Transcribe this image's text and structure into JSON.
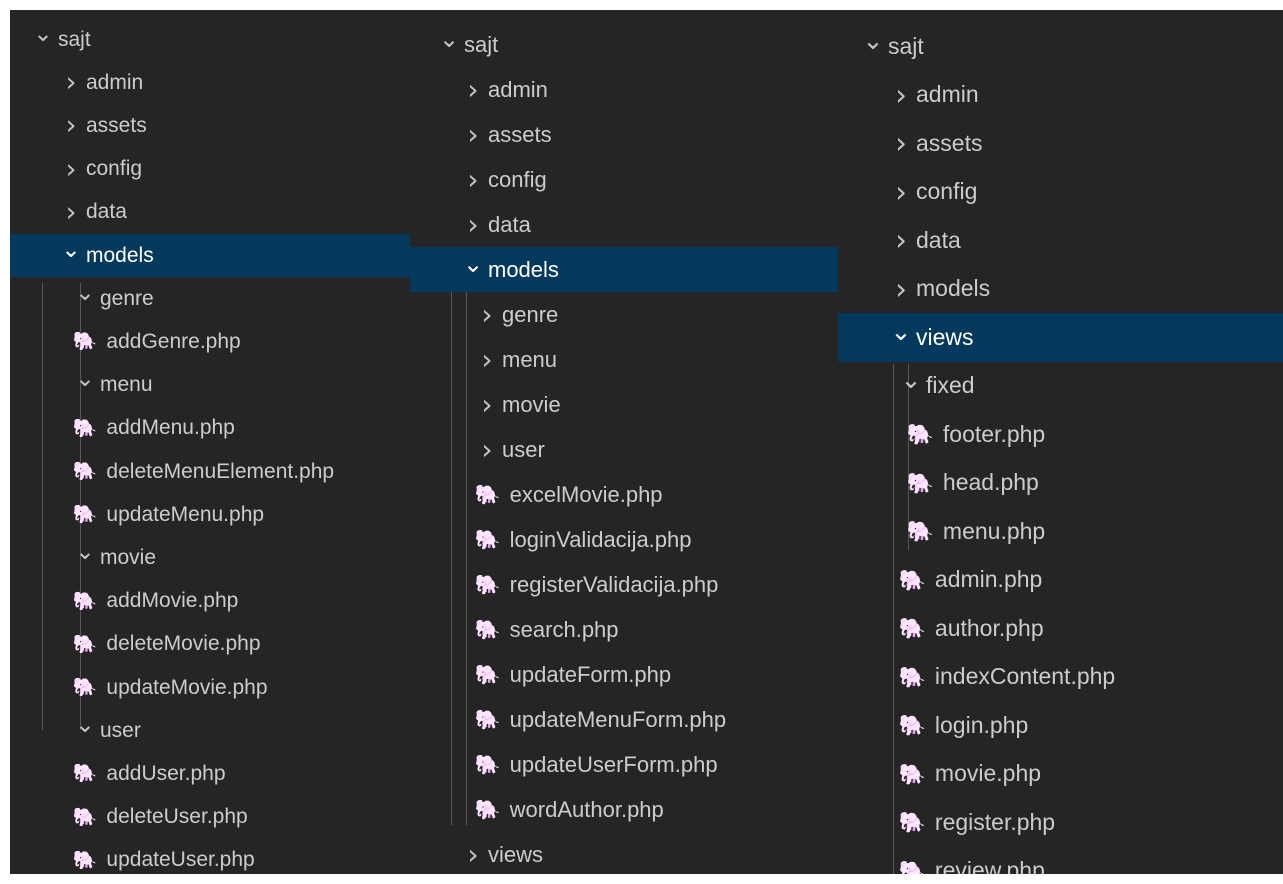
{
  "explorer_left": {
    "rows": [
      {
        "label": "sajt",
        "kind": "folder",
        "expanded": true,
        "depth": 0
      },
      {
        "label": "admin",
        "kind": "folder",
        "expanded": false,
        "depth": 1
      },
      {
        "label": "assets",
        "kind": "folder",
        "expanded": false,
        "depth": 1
      },
      {
        "label": "config",
        "kind": "folder",
        "expanded": false,
        "depth": 1
      },
      {
        "label": "data",
        "kind": "folder",
        "expanded": false,
        "depth": 1
      },
      {
        "label": "models",
        "kind": "folder",
        "expanded": true,
        "depth": 1,
        "selected": true
      },
      {
        "label": "genre",
        "kind": "folder",
        "expanded": true,
        "depth": 2
      },
      {
        "label": "addGenre.php",
        "kind": "php",
        "depth": 3
      },
      {
        "label": "menu",
        "kind": "folder",
        "expanded": true,
        "depth": 2
      },
      {
        "label": "addMenu.php",
        "kind": "php",
        "depth": 3
      },
      {
        "label": "deleteMenuElement.php",
        "kind": "php",
        "depth": 3
      },
      {
        "label": "updateMenu.php",
        "kind": "php",
        "depth": 3
      },
      {
        "label": "movie",
        "kind": "folder",
        "expanded": true,
        "depth": 2
      },
      {
        "label": "addMovie.php",
        "kind": "php",
        "depth": 3
      },
      {
        "label": "deleteMovie.php",
        "kind": "php",
        "depth": 3
      },
      {
        "label": "updateMovie.php",
        "kind": "php",
        "depth": 3
      },
      {
        "label": "user",
        "kind": "folder",
        "expanded": true,
        "depth": 2
      },
      {
        "label": "addUser.php",
        "kind": "php",
        "depth": 3
      },
      {
        "label": "deleteUser.php",
        "kind": "php",
        "depth": 3
      },
      {
        "label": "updateUser.php",
        "kind": "php",
        "depth": 3
      }
    ]
  },
  "explorer_middle": {
    "rows": [
      {
        "label": "sajt",
        "kind": "folder",
        "expanded": true,
        "depth": 0
      },
      {
        "label": "admin",
        "kind": "folder",
        "expanded": false,
        "depth": 1
      },
      {
        "label": "assets",
        "kind": "folder",
        "expanded": false,
        "depth": 1
      },
      {
        "label": "config",
        "kind": "folder",
        "expanded": false,
        "depth": 1
      },
      {
        "label": "data",
        "kind": "folder",
        "expanded": false,
        "depth": 1
      },
      {
        "label": "models",
        "kind": "folder",
        "expanded": true,
        "depth": 1,
        "selected": true
      },
      {
        "label": "genre",
        "kind": "folder",
        "expanded": false,
        "depth": 2
      },
      {
        "label": "menu",
        "kind": "folder",
        "expanded": false,
        "depth": 2
      },
      {
        "label": "movie",
        "kind": "folder",
        "expanded": false,
        "depth": 2
      },
      {
        "label": "user",
        "kind": "folder",
        "expanded": false,
        "depth": 2
      },
      {
        "label": "excelMovie.php",
        "kind": "php",
        "depth": 2
      },
      {
        "label": "loginValidacija.php",
        "kind": "php",
        "depth": 2
      },
      {
        "label": "registerValidacija.php",
        "kind": "php",
        "depth": 2
      },
      {
        "label": "search.php",
        "kind": "php",
        "depth": 2
      },
      {
        "label": "updateForm.php",
        "kind": "php",
        "depth": 2
      },
      {
        "label": "updateMenuForm.php",
        "kind": "php",
        "depth": 2
      },
      {
        "label": "updateUserForm.php",
        "kind": "php",
        "depth": 2
      },
      {
        "label": "wordAuthor.php",
        "kind": "php",
        "depth": 2
      },
      {
        "label": "views",
        "kind": "folder",
        "expanded": false,
        "depth": 1
      }
    ]
  },
  "explorer_right": {
    "rows": [
      {
        "label": "sajt",
        "kind": "folder",
        "expanded": true,
        "depth": 0
      },
      {
        "label": "admin",
        "kind": "folder",
        "expanded": false,
        "depth": 1
      },
      {
        "label": "assets",
        "kind": "folder",
        "expanded": false,
        "depth": 1
      },
      {
        "label": "config",
        "kind": "folder",
        "expanded": false,
        "depth": 1
      },
      {
        "label": "data",
        "kind": "folder",
        "expanded": false,
        "depth": 1
      },
      {
        "label": "models",
        "kind": "folder",
        "expanded": false,
        "depth": 1
      },
      {
        "label": "views",
        "kind": "folder",
        "expanded": true,
        "depth": 1,
        "selected": true
      },
      {
        "label": "fixed",
        "kind": "folder",
        "expanded": true,
        "depth": 2
      },
      {
        "label": "footer.php",
        "kind": "php",
        "depth": 3
      },
      {
        "label": "head.php",
        "kind": "php",
        "depth": 3
      },
      {
        "label": "menu.php",
        "kind": "php",
        "depth": 3
      },
      {
        "label": "admin.php",
        "kind": "php",
        "depth": 2
      },
      {
        "label": "author.php",
        "kind": "php",
        "depth": 2
      },
      {
        "label": "indexContent.php",
        "kind": "php",
        "depth": 2
      },
      {
        "label": "login.php",
        "kind": "php",
        "depth": 2
      },
      {
        "label": "movie.php",
        "kind": "php",
        "depth": 2
      },
      {
        "label": "register.php",
        "kind": "php",
        "depth": 2
      },
      {
        "label": "review.php",
        "kind": "php",
        "depth": 2
      }
    ]
  },
  "icons": {
    "expanded": "chevron-down-icon",
    "collapsed": "chevron-right-icon",
    "php_file": "php-elephant-icon"
  },
  "colors": {
    "sidebar_bg": "#252526",
    "selected_bg": "#04395e",
    "text": "#cccccc",
    "php_icon": "#a074c4"
  }
}
